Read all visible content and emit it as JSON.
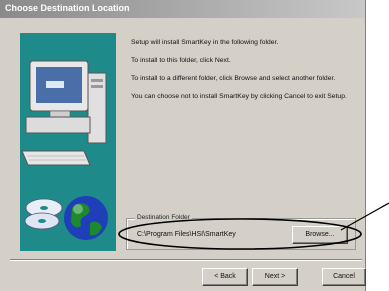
{
  "window": {
    "title": "Choose Destination Location"
  },
  "body_text": [
    "Setup will install SmartKey in the following folder.",
    "To install to this folder, click Next.",
    "To install to a different folder, click Browse and select another folder.",
    "You can choose not to install SmartKey by clicking Cancel to exit Setup."
  ],
  "destination": {
    "legend": "Destination Folder",
    "path": "C:\\Program Files\\HSI\\SmartKey",
    "browse_label": "Browse..."
  },
  "footer": {
    "back_label": "< Back",
    "next_label": "Next >",
    "cancel_label": "Cancel"
  },
  "colors": {
    "art_background": "#1f8a8a",
    "dialog_face": "#d4d0c8"
  }
}
